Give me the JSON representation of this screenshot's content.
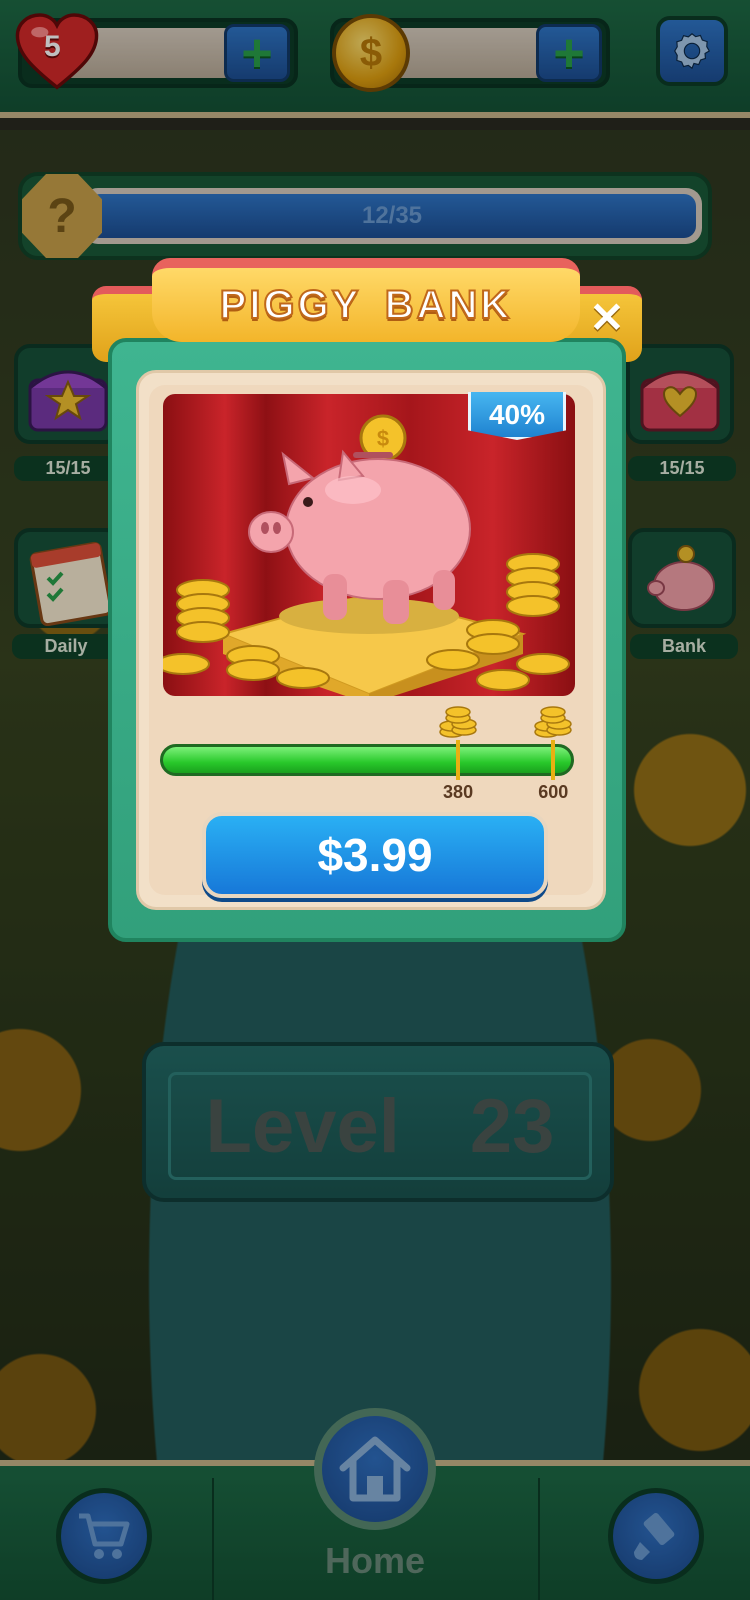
{
  "top_bar": {
    "lives": "5",
    "lives_add_label": "+",
    "coins_symbol": "$",
    "coins_add_label": "+"
  },
  "quest": {
    "icon_label": "?",
    "progress_text": "12/35"
  },
  "side_buttons": {
    "left_chest_count": "15/15",
    "right_chest_count": "15/15",
    "daily_label": "Daily",
    "bank_label": "Bank"
  },
  "piggy_bank": {
    "title": "PIGGY BANK",
    "close_label": "✕",
    "discount_badge": "40%",
    "progress_fraction": 1.0,
    "milestones": [
      {
        "label": "380",
        "fraction": 0.72
      },
      {
        "label": "600",
        "fraction": 0.95
      }
    ],
    "price": "$3.99"
  },
  "level": {
    "word": "Level",
    "number": "23"
  },
  "bottom_nav": {
    "home_label": "Home"
  },
  "colors": {
    "panel_green": "#32a07b",
    "ribbon_gold": "#f3b52a",
    "price_blue": "#1f8ce0",
    "progress_green": "#28c82a"
  },
  "icons": [
    "heart-icon",
    "plus-icon",
    "coin-icon",
    "gear-icon",
    "question-icon",
    "chest-icon",
    "calendar-icon",
    "piggy-icon",
    "close-icon",
    "cart-icon",
    "home-icon",
    "brush-icon"
  ]
}
